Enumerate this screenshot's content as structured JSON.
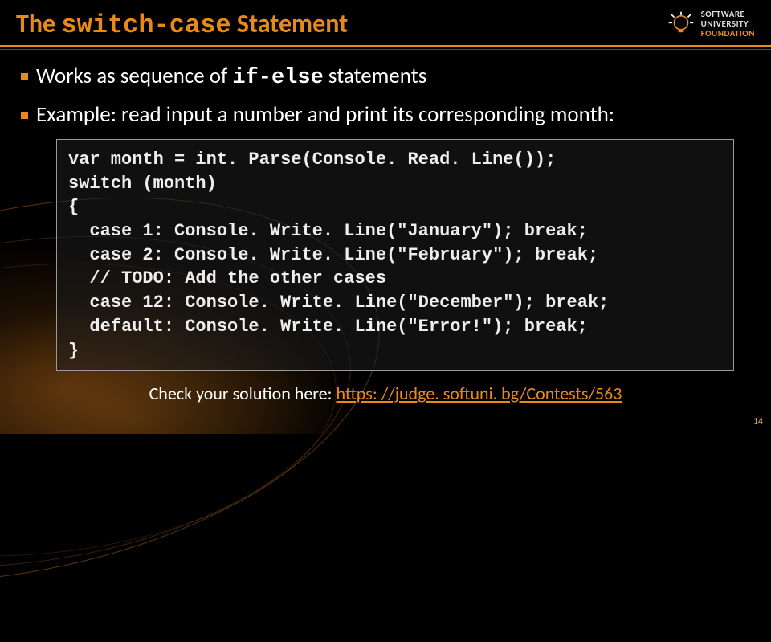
{
  "header": {
    "title_prefix": "The ",
    "title_code": "switch-case",
    "title_suffix": " Statement",
    "logo_line1": "SOFTWARE",
    "logo_line2": "UNIVERSITY",
    "logo_line3": "FOUNDATION"
  },
  "bullets": {
    "b1_prefix": "Works as sequence of ",
    "b1_code": "if-else",
    "b1_suffix": " statements",
    "b2": "Example: read input a number and print its corresponding month:"
  },
  "code": "var month = int. Parse(Console. Read. Line());\nswitch (month)\n{\n  case 1: Console. Write. Line(\"January\"); break;\n  case 2: Console. Write. Line(\"February\"); break;\n  // TODO: Add the other cases\n  case 12: Console. Write. Line(\"December\"); break;\n  default: Console. Write. Line(\"Error!\"); break;\n}",
  "check": {
    "prefix": "Check your solution here: ",
    "link": "https: //judge. softuni. bg/Contests/563"
  },
  "page_number": "14"
}
